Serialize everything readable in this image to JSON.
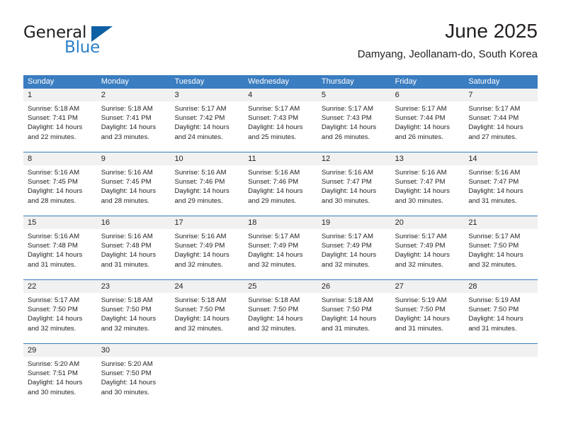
{
  "branding": {
    "logo_text_primary": "General",
    "logo_text_secondary": "Blue",
    "logo_icon": "triangle-icon",
    "primary_color": "#3a7dc0",
    "logo_blue": "#2a7fc9",
    "logo_triangle_color": "#0e5fa4"
  },
  "header": {
    "title": "June 2025",
    "subtitle": "Damyang, Jeollanam-do, South Korea"
  },
  "weekdays": [
    "Sunday",
    "Monday",
    "Tuesday",
    "Wednesday",
    "Thursday",
    "Friday",
    "Saturday"
  ],
  "weeks": [
    [
      {
        "day": "1",
        "sunrise": "Sunrise: 5:18 AM",
        "sunset": "Sunset: 7:41 PM",
        "daylight_1": "Daylight: 14 hours",
        "daylight_2": "and 22 minutes."
      },
      {
        "day": "2",
        "sunrise": "Sunrise: 5:18 AM",
        "sunset": "Sunset: 7:41 PM",
        "daylight_1": "Daylight: 14 hours",
        "daylight_2": "and 23 minutes."
      },
      {
        "day": "3",
        "sunrise": "Sunrise: 5:17 AM",
        "sunset": "Sunset: 7:42 PM",
        "daylight_1": "Daylight: 14 hours",
        "daylight_2": "and 24 minutes."
      },
      {
        "day": "4",
        "sunrise": "Sunrise: 5:17 AM",
        "sunset": "Sunset: 7:43 PM",
        "daylight_1": "Daylight: 14 hours",
        "daylight_2": "and 25 minutes."
      },
      {
        "day": "5",
        "sunrise": "Sunrise: 5:17 AM",
        "sunset": "Sunset: 7:43 PM",
        "daylight_1": "Daylight: 14 hours",
        "daylight_2": "and 26 minutes."
      },
      {
        "day": "6",
        "sunrise": "Sunrise: 5:17 AM",
        "sunset": "Sunset: 7:44 PM",
        "daylight_1": "Daylight: 14 hours",
        "daylight_2": "and 26 minutes."
      },
      {
        "day": "7",
        "sunrise": "Sunrise: 5:17 AM",
        "sunset": "Sunset: 7:44 PM",
        "daylight_1": "Daylight: 14 hours",
        "daylight_2": "and 27 minutes."
      }
    ],
    [
      {
        "day": "8",
        "sunrise": "Sunrise: 5:16 AM",
        "sunset": "Sunset: 7:45 PM",
        "daylight_1": "Daylight: 14 hours",
        "daylight_2": "and 28 minutes."
      },
      {
        "day": "9",
        "sunrise": "Sunrise: 5:16 AM",
        "sunset": "Sunset: 7:45 PM",
        "daylight_1": "Daylight: 14 hours",
        "daylight_2": "and 28 minutes."
      },
      {
        "day": "10",
        "sunrise": "Sunrise: 5:16 AM",
        "sunset": "Sunset: 7:46 PM",
        "daylight_1": "Daylight: 14 hours",
        "daylight_2": "and 29 minutes."
      },
      {
        "day": "11",
        "sunrise": "Sunrise: 5:16 AM",
        "sunset": "Sunset: 7:46 PM",
        "daylight_1": "Daylight: 14 hours",
        "daylight_2": "and 29 minutes."
      },
      {
        "day": "12",
        "sunrise": "Sunrise: 5:16 AM",
        "sunset": "Sunset: 7:47 PM",
        "daylight_1": "Daylight: 14 hours",
        "daylight_2": "and 30 minutes."
      },
      {
        "day": "13",
        "sunrise": "Sunrise: 5:16 AM",
        "sunset": "Sunset: 7:47 PM",
        "daylight_1": "Daylight: 14 hours",
        "daylight_2": "and 30 minutes."
      },
      {
        "day": "14",
        "sunrise": "Sunrise: 5:16 AM",
        "sunset": "Sunset: 7:47 PM",
        "daylight_1": "Daylight: 14 hours",
        "daylight_2": "and 31 minutes."
      }
    ],
    [
      {
        "day": "15",
        "sunrise": "Sunrise: 5:16 AM",
        "sunset": "Sunset: 7:48 PM",
        "daylight_1": "Daylight: 14 hours",
        "daylight_2": "and 31 minutes."
      },
      {
        "day": "16",
        "sunrise": "Sunrise: 5:16 AM",
        "sunset": "Sunset: 7:48 PM",
        "daylight_1": "Daylight: 14 hours",
        "daylight_2": "and 31 minutes."
      },
      {
        "day": "17",
        "sunrise": "Sunrise: 5:16 AM",
        "sunset": "Sunset: 7:49 PM",
        "daylight_1": "Daylight: 14 hours",
        "daylight_2": "and 32 minutes."
      },
      {
        "day": "18",
        "sunrise": "Sunrise: 5:17 AM",
        "sunset": "Sunset: 7:49 PM",
        "daylight_1": "Daylight: 14 hours",
        "daylight_2": "and 32 minutes."
      },
      {
        "day": "19",
        "sunrise": "Sunrise: 5:17 AM",
        "sunset": "Sunset: 7:49 PM",
        "daylight_1": "Daylight: 14 hours",
        "daylight_2": "and 32 minutes."
      },
      {
        "day": "20",
        "sunrise": "Sunrise: 5:17 AM",
        "sunset": "Sunset: 7:49 PM",
        "daylight_1": "Daylight: 14 hours",
        "daylight_2": "and 32 minutes."
      },
      {
        "day": "21",
        "sunrise": "Sunrise: 5:17 AM",
        "sunset": "Sunset: 7:50 PM",
        "daylight_1": "Daylight: 14 hours",
        "daylight_2": "and 32 minutes."
      }
    ],
    [
      {
        "day": "22",
        "sunrise": "Sunrise: 5:17 AM",
        "sunset": "Sunset: 7:50 PM",
        "daylight_1": "Daylight: 14 hours",
        "daylight_2": "and 32 minutes."
      },
      {
        "day": "23",
        "sunrise": "Sunrise: 5:18 AM",
        "sunset": "Sunset: 7:50 PM",
        "daylight_1": "Daylight: 14 hours",
        "daylight_2": "and 32 minutes."
      },
      {
        "day": "24",
        "sunrise": "Sunrise: 5:18 AM",
        "sunset": "Sunset: 7:50 PM",
        "daylight_1": "Daylight: 14 hours",
        "daylight_2": "and 32 minutes."
      },
      {
        "day": "25",
        "sunrise": "Sunrise: 5:18 AM",
        "sunset": "Sunset: 7:50 PM",
        "daylight_1": "Daylight: 14 hours",
        "daylight_2": "and 32 minutes."
      },
      {
        "day": "26",
        "sunrise": "Sunrise: 5:18 AM",
        "sunset": "Sunset: 7:50 PM",
        "daylight_1": "Daylight: 14 hours",
        "daylight_2": "and 31 minutes."
      },
      {
        "day": "27",
        "sunrise": "Sunrise: 5:19 AM",
        "sunset": "Sunset: 7:50 PM",
        "daylight_1": "Daylight: 14 hours",
        "daylight_2": "and 31 minutes."
      },
      {
        "day": "28",
        "sunrise": "Sunrise: 5:19 AM",
        "sunset": "Sunset: 7:50 PM",
        "daylight_1": "Daylight: 14 hours",
        "daylight_2": "and 31 minutes."
      }
    ],
    [
      {
        "day": "29",
        "sunrise": "Sunrise: 5:20 AM",
        "sunset": "Sunset: 7:51 PM",
        "daylight_1": "Daylight: 14 hours",
        "daylight_2": "and 30 minutes."
      },
      {
        "day": "30",
        "sunrise": "Sunrise: 5:20 AM",
        "sunset": "Sunset: 7:50 PM",
        "daylight_1": "Daylight: 14 hours",
        "daylight_2": "and 30 minutes."
      },
      {
        "day": "",
        "sunrise": "",
        "sunset": "",
        "daylight_1": "",
        "daylight_2": ""
      },
      {
        "day": "",
        "sunrise": "",
        "sunset": "",
        "daylight_1": "",
        "daylight_2": ""
      },
      {
        "day": "",
        "sunrise": "",
        "sunset": "",
        "daylight_1": "",
        "daylight_2": ""
      },
      {
        "day": "",
        "sunrise": "",
        "sunset": "",
        "daylight_1": "",
        "daylight_2": ""
      },
      {
        "day": "",
        "sunrise": "",
        "sunset": "",
        "daylight_1": "",
        "daylight_2": ""
      }
    ]
  ]
}
